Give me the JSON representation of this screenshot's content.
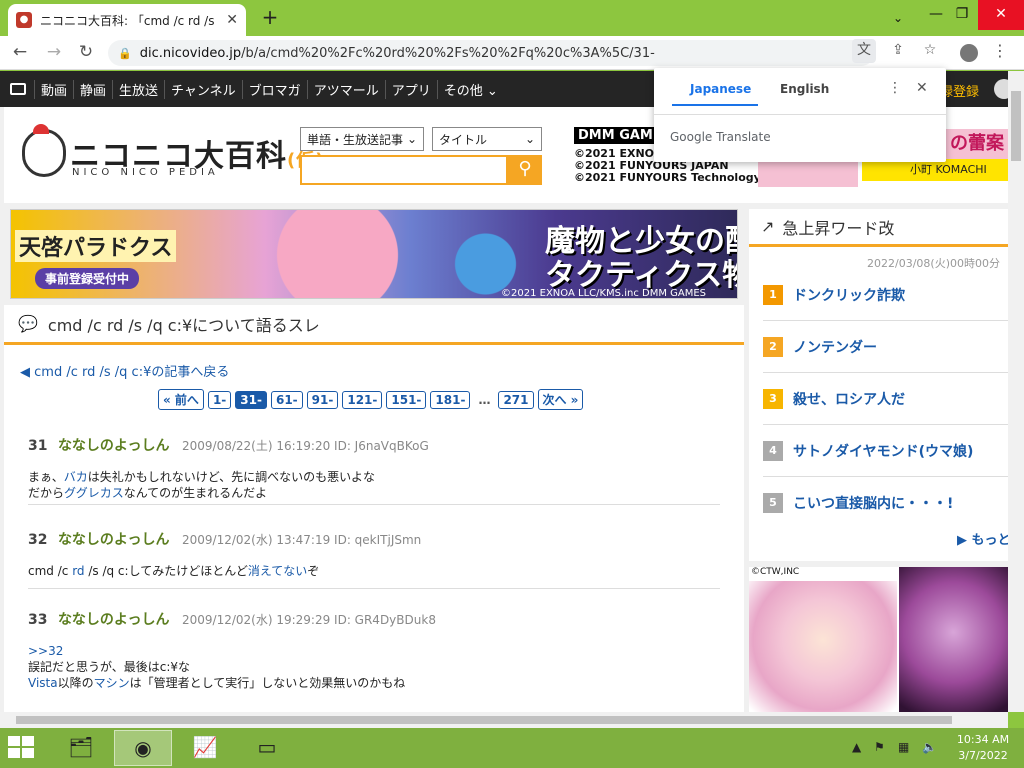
{
  "browser": {
    "tab_title": "ニコニコ大百科: 「cmd /c rd /s /q c:",
    "url_host": "dic.nicovideo.jp",
    "url_path": "/b/a/cmd%20%2Fc%20rd%20%2Fs%20%2Fq%20c%3A%5C/31-",
    "icons": [
      "back-icon",
      "forward-icon",
      "reload-icon",
      "lock-icon",
      "translate-icon",
      "share-icon",
      "star-icon",
      "profile-icon",
      "kebab-icon"
    ]
  },
  "translate_popup": {
    "tab_ja": "Japanese",
    "tab_en": "English",
    "brand": "Google Translate"
  },
  "nicobar": {
    "items": [
      "動画",
      "静画",
      "生放送",
      "チャンネル",
      "ブロマガ",
      "アツマール",
      "アプリ",
      "その他"
    ],
    "login": "録登録"
  },
  "header": {
    "logo_ja": "ニコニコ大百科",
    "logo_paren": "(仮)",
    "logo_en": "NICO NICO PEDIA",
    "select1": "単語・生放送記事",
    "select2": "タイトル",
    "search_placeholder": ""
  },
  "ad_top": {
    "brand": "DMM GAMES",
    "c1": "©2021 EXNOA",
    "c2": "©2021 FUNYOURS JAPAN",
    "c3": "©2021 FUNYOURS Technology",
    "right_text": "の蕾案",
    "credit": "小町 KOMACHI"
  },
  "banner": {
    "left_title": "天啓パラドクス",
    "left_sub": "事前登録受付中",
    "right_line1": "魔物と少女の配合",
    "right_line2": "タクティクス物語",
    "copyright": "©2021 EXNOA LLC/KMS.inc DMM GAMES"
  },
  "thread": {
    "title": "cmd /c rd /s /q c:¥について語るスレ",
    "back_link": "cmd /c rd /s /q c:¥の記事へ戻る",
    "pager": [
      "« 前へ",
      "1-",
      "31-",
      "61-",
      "91-",
      "121-",
      "151-",
      "181-",
      "…",
      "271",
      "次へ »"
    ],
    "posts": [
      {
        "num": "31",
        "name": "ななしのよっしん",
        "meta": "2009/08/22(土) 16:19:20 ID: J6naVqBKoG",
        "l1a": "まぁ、",
        "l1link": "バカ",
        "l1b": "は失礼かもしれないけど、先に調べないのも悪いよな",
        "l2a": "だから",
        "l2link": "ググレカス",
        "l2b": "なんてのが生まれるんだよ"
      },
      {
        "num": "32",
        "name": "ななしのよっしん",
        "meta": "2009/12/02(水) 13:47:19 ID: qekITjJSmn",
        "l1a": "cmd /c ",
        "l1link": "rd",
        "l1b": " /s /q c:してみたけどほとんど",
        "l1link2": "消えてない",
        "l1c": "ぞ"
      },
      {
        "num": "33",
        "name": "ななしのよっしん",
        "meta": "2009/12/02(水) 19:29:29 ID: GR4DyBDuk8",
        "ref": ">>32",
        "l2": "誤記だと思うが、最後はc:¥な",
        "l3link1": "Vista",
        "l3a": "以降の",
        "l3link2": "マシン",
        "l3b": "は「管理者として実行」しないと効果無いのかもね"
      }
    ]
  },
  "sidebar": {
    "title": "急上昇ワード改",
    "date": "2022/03/08(火)00時00分",
    "ranks": [
      {
        "no": "1",
        "word": "ドンクリック詐欺",
        "color": "#f39800"
      },
      {
        "no": "2",
        "word": "ノンテンダー",
        "color": "#f5a623"
      },
      {
        "no": "3",
        "word": "殺せ、ロシア人だ",
        "color": "#f7b500"
      },
      {
        "no": "4",
        "word": "サトノダイヤモンド(ウマ娘)",
        "color": "#aaaaaa"
      },
      {
        "no": "5",
        "word": "こいつ直接脳内に・・・!",
        "color": "#aaaaaa"
      }
    ],
    "more": "▶ もっと",
    "ad_credit": "©CTW,INC"
  },
  "taskbar": {
    "time": "10:34 AM",
    "date": "3/7/2022"
  }
}
